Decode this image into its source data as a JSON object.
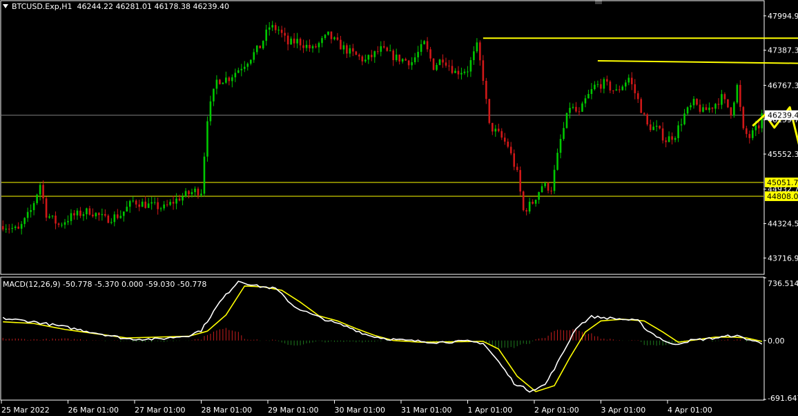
{
  "header": {
    "symbol": "BTCUSD.Exp,H1",
    "ohlc": "46244.22 46281.01 46178.38 46239.40"
  },
  "indicator": {
    "label": "MACD(12,26,9)",
    "values": "-50.778 -5.370 0.000 -59.030 -50.778"
  },
  "colors": {
    "background": "#000000",
    "bull": "#00c800",
    "bear": "#d01818",
    "annotation": "#ffff00",
    "macd_line": "#ffffff",
    "signal_line": "#ffff00",
    "grid_line": "#808080"
  },
  "chart_data": {
    "type": "candlestick",
    "price_axis": {
      "ylim": [
        43440,
        48250
      ],
      "ticks": [
        "47994.9",
        "47387.3",
        "46767.3",
        "46159.7",
        "45552.3",
        "44932.7",
        "44324.5",
        "43716.9"
      ]
    },
    "current_price": {
      "value": 46239.4,
      "label": "46239.4"
    },
    "horizontal_levels": [
      {
        "value": 45051.7,
        "label": "45051.7"
      },
      {
        "value": 44808.0,
        "label": "44808.0"
      }
    ],
    "x_axis_labels": [
      "25 Mar 2022",
      "26 Mar 01:00",
      "27 Mar 01:00",
      "28 Mar 01:00",
      "29 Mar 01:00",
      "30 Mar 01:00",
      "31 Mar 01:00",
      "1 Apr 01:00",
      "2 Apr 01:00",
      "3 Apr 01:00",
      "4 Apr 01:00"
    ],
    "close_waypoints": [
      [
        0,
        44300
      ],
      [
        5,
        44200
      ],
      [
        9,
        44550
      ],
      [
        12,
        45020
      ],
      [
        14,
        44500
      ],
      [
        18,
        44300
      ],
      [
        22,
        44450
      ],
      [
        28,
        44550
      ],
      [
        33,
        44400
      ],
      [
        38,
        44480
      ],
      [
        42,
        44720
      ],
      [
        47,
        44650
      ],
      [
        52,
        44600
      ],
      [
        57,
        44780
      ],
      [
        62,
        44900
      ],
      [
        64,
        44900
      ],
      [
        66,
        46200
      ],
      [
        69,
        46850
      ],
      [
        73,
        46900
      ],
      [
        78,
        47150
      ],
      [
        83,
        47450
      ],
      [
        86,
        47800
      ],
      [
        89,
        47750
      ],
      [
        92,
        47500
      ],
      [
        95,
        47550
      ],
      [
        100,
        47400
      ],
      [
        105,
        47650
      ],
      [
        108,
        47500
      ],
      [
        112,
        47350
      ],
      [
        117,
        47200
      ],
      [
        122,
        47400
      ],
      [
        127,
        47250
      ],
      [
        132,
        47180
      ],
      [
        136,
        47500
      ],
      [
        139,
        47100
      ],
      [
        142,
        47250
      ],
      [
        146,
        47000
      ],
      [
        150,
        47050
      ],
      [
        153,
        47450
      ],
      [
        155,
        46900
      ],
      [
        157,
        46050
      ],
      [
        160,
        45900
      ],
      [
        163,
        45700
      ],
      [
        166,
        45200
      ],
      [
        168,
        44550
      ],
      [
        171,
        44700
      ],
      [
        174,
        45000
      ],
      [
        177,
        44950
      ],
      [
        180,
        45800
      ],
      [
        183,
        46400
      ],
      [
        186,
        46250
      ],
      [
        188,
        46500
      ],
      [
        191,
        46750
      ],
      [
        194,
        46800
      ],
      [
        198,
        46650
      ],
      [
        202,
        46900
      ],
      [
        205,
        46500
      ],
      [
        208,
        46050
      ],
      [
        211,
        46000
      ],
      [
        214,
        45800
      ],
      [
        217,
        45900
      ],
      [
        220,
        46250
      ],
      [
        223,
        46450
      ],
      [
        226,
        46300
      ],
      [
        229,
        46400
      ],
      [
        232,
        46550
      ],
      [
        235,
        46300
      ],
      [
        237,
        46750
      ],
      [
        239,
        45950
      ],
      [
        241,
        45850
      ],
      [
        244,
        46050
      ],
      [
        245,
        46239
      ]
    ],
    "drawn_levels": [
      {
        "from": [
          155,
          47600
        ],
        "to": [
          268,
          47600
        ]
      },
      {
        "from": [
          192,
          47200
        ],
        "to": [
          266,
          47150
        ]
      }
    ],
    "projection_path": [
      [
        242,
        46050
      ],
      [
        246,
        46250
      ],
      [
        249,
        46020
      ],
      [
        254,
        46380
      ],
      [
        257,
        45710
      ],
      [
        260,
        45950
      ],
      [
        265,
        45010
      ]
    ],
    "macd_axis": {
      "ylim": [
        -691.647,
        736.514
      ],
      "ticks": [
        "736.514",
        "0.00",
        "-691.647"
      ]
    },
    "macd_waypoints": [
      [
        0,
        260
      ],
      [
        10,
        220
      ],
      [
        20,
        160
      ],
      [
        30,
        90
      ],
      [
        40,
        20
      ],
      [
        50,
        15
      ],
      [
        60,
        60
      ],
      [
        64,
        120
      ],
      [
        70,
        450
      ],
      [
        76,
        700
      ],
      [
        82,
        640
      ],
      [
        88,
        610
      ],
      [
        94,
        400
      ],
      [
        100,
        300
      ],
      [
        106,
        220
      ],
      [
        112,
        150
      ],
      [
        118,
        60
      ],
      [
        124,
        20
      ],
      [
        130,
        0
      ],
      [
        140,
        -20
      ],
      [
        150,
        -10
      ],
      [
        155,
        -30
      ],
      [
        160,
        -250
      ],
      [
        165,
        -500
      ],
      [
        170,
        -590
      ],
      [
        175,
        -520
      ],
      [
        180,
        -200
      ],
      [
        185,
        150
      ],
      [
        190,
        280
      ],
      [
        200,
        250
      ],
      [
        205,
        230
      ],
      [
        208,
        120
      ],
      [
        212,
        30
      ],
      [
        216,
        -50
      ],
      [
        222,
        0
      ],
      [
        230,
        30
      ],
      [
        236,
        60
      ],
      [
        240,
        20
      ],
      [
        245,
        -35
      ]
    ],
    "signal_waypoints": [
      [
        0,
        220
      ],
      [
        10,
        200
      ],
      [
        20,
        130
      ],
      [
        30,
        80
      ],
      [
        40,
        30
      ],
      [
        50,
        40
      ],
      [
        60,
        50
      ],
      [
        66,
        110
      ],
      [
        72,
        300
      ],
      [
        78,
        640
      ],
      [
        84,
        630
      ],
      [
        90,
        590
      ],
      [
        96,
        450
      ],
      [
        102,
        290
      ],
      [
        108,
        230
      ],
      [
        114,
        140
      ],
      [
        120,
        60
      ],
      [
        126,
        0
      ],
      [
        135,
        -20
      ],
      [
        145,
        -15
      ],
      [
        155,
        -10
      ],
      [
        160,
        -100
      ],
      [
        166,
        -420
      ],
      [
        172,
        -600
      ],
      [
        178,
        -530
      ],
      [
        183,
        -200
      ],
      [
        188,
        100
      ],
      [
        193,
        230
      ],
      [
        200,
        250
      ],
      [
        207,
        230
      ],
      [
        213,
        100
      ],
      [
        218,
        -20
      ],
      [
        224,
        10
      ],
      [
        230,
        40
      ],
      [
        236,
        40
      ],
      [
        240,
        30
      ],
      [
        245,
        -10
      ]
    ]
  }
}
